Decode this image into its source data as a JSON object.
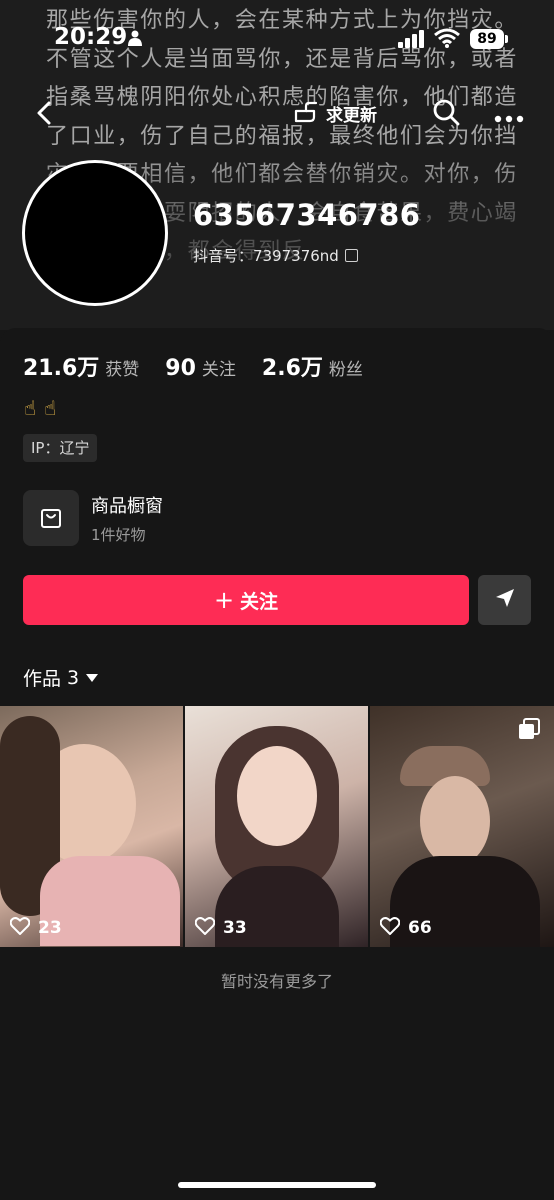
{
  "background_text": "那些伤害你的人，会在某种方式上为你挡灾。不管这个人是当面骂你，还是背后骂你，或者指桑骂槐阴阳你处心积虑的陷害你，他们都造了口业，伤了自己的福报，最终他们会为你挡灾。你要相信，他们都会替你销灾。对你，伤害你，背后耍阴招的人，会自食苦果，费心竭力伤害你的，都会得到反",
  "status_bar": {
    "time": "20:29",
    "battery": "89"
  },
  "nav": {
    "update_label": "求更新"
  },
  "profile": {
    "username": "63567346786",
    "douyin_id": "抖音号：7397376nd"
  },
  "stats": [
    {
      "value": "21.6万",
      "label": "获赞"
    },
    {
      "value": "90",
      "label": "关注"
    },
    {
      "value": "2.6万",
      "label": "粉丝"
    }
  ],
  "bio_emoji": "☝☝",
  "ip": "IP：辽宁",
  "shop": {
    "title": "商品橱窗",
    "subtitle": "1件好物"
  },
  "follow_label": "关注",
  "works": {
    "label": "作品",
    "count": "3"
  },
  "videos": [
    {
      "likes": "23"
    },
    {
      "likes": "33"
    },
    {
      "likes": "66"
    }
  ],
  "footer_text": "暂时没有更多了",
  "colors": {
    "follow": "#fe2c55",
    "panel": "#161616"
  }
}
